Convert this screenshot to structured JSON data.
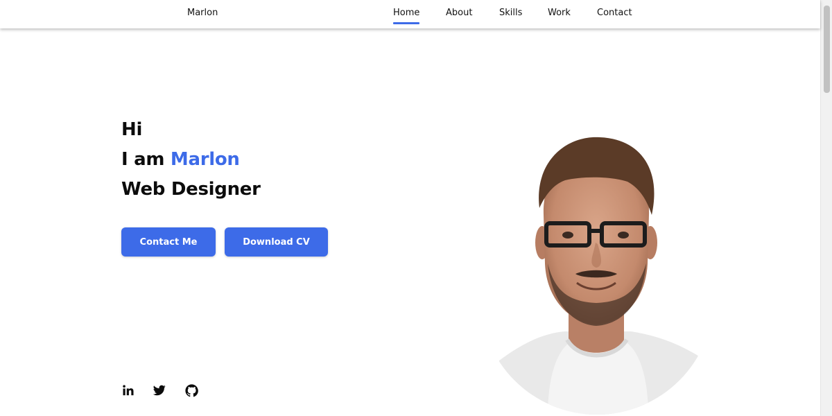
{
  "header": {
    "brand": "Marlon",
    "nav": [
      {
        "label": "Home",
        "active": true
      },
      {
        "label": "About",
        "active": false
      },
      {
        "label": "Skills",
        "active": false
      },
      {
        "label": "Work",
        "active": false
      },
      {
        "label": "Contact",
        "active": false
      }
    ]
  },
  "hero": {
    "line1": "Hi",
    "line2_prefix": "I am ",
    "line2_name": "Marlon",
    "line3": "Web Designer"
  },
  "buttons": {
    "contact": "Contact Me",
    "download": "Download CV"
  },
  "social": [
    {
      "icon": "linkedin-icon"
    },
    {
      "icon": "twitter-icon"
    },
    {
      "icon": "github-icon"
    }
  ],
  "colors": {
    "accent": "#3d6be8",
    "text": "#0c0c0c",
    "background": "#ffffff"
  }
}
